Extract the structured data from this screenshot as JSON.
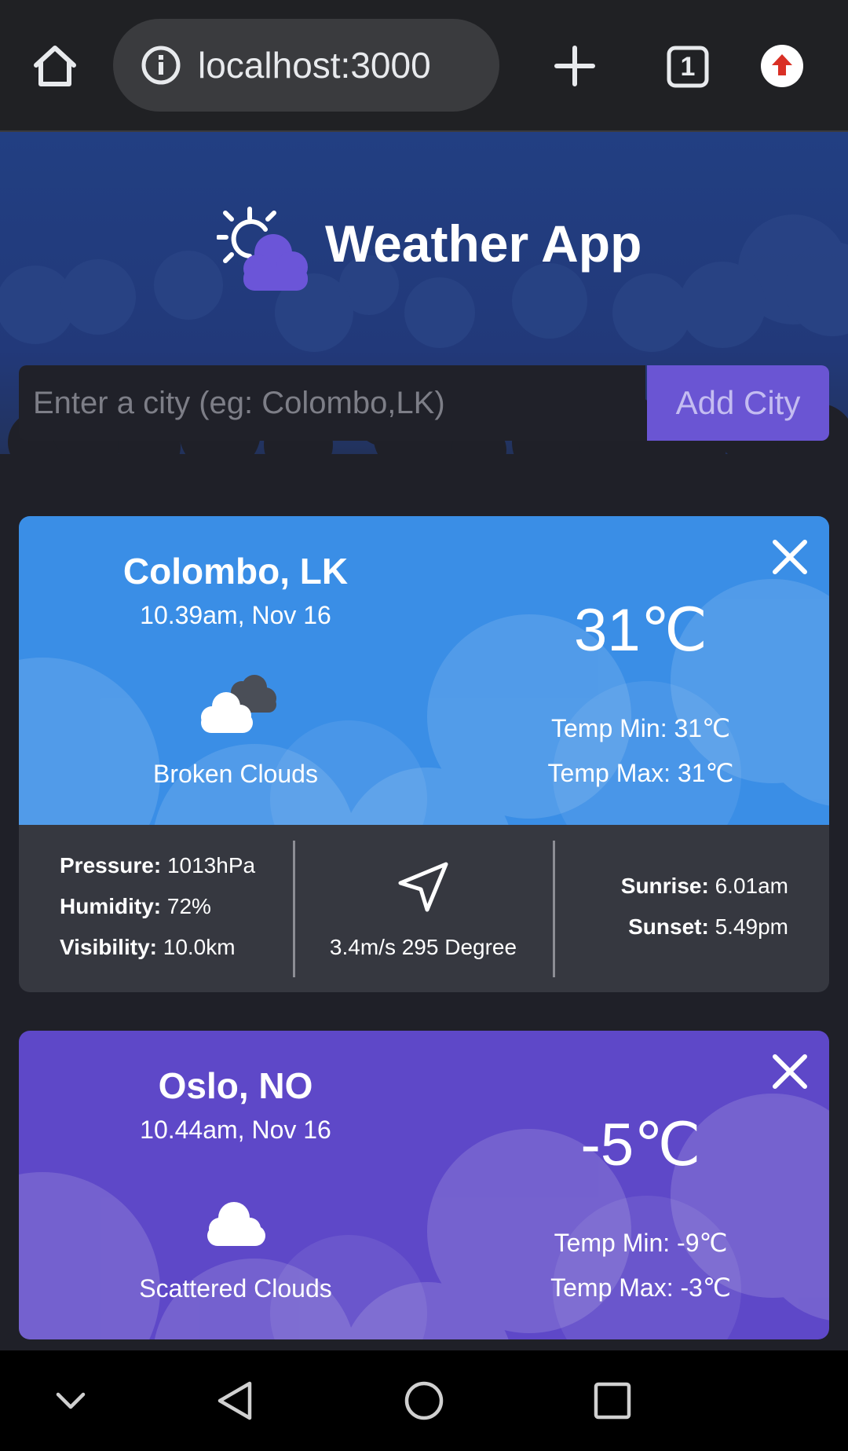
{
  "browser": {
    "url": "localhost:3000",
    "tab_count": "1"
  },
  "app": {
    "title": "Weather App"
  },
  "search": {
    "placeholder": "Enter a city (eg: Colombo,LK)",
    "value": "",
    "button_label": "Add City"
  },
  "cards": [
    {
      "city": "Colombo, LK",
      "time": "10.39am, Nov 16",
      "description": "Broken Clouds",
      "temp": "31℃",
      "temp_min": "Temp Min: 31℃",
      "temp_max": "Temp Max: 31℃",
      "icon": "broken-clouds-icon",
      "color": "#3a8ee6",
      "pressure_label": "Pressure:",
      "pressure": "1013hPa",
      "humidity_label": "Humidity:",
      "humidity": "72%",
      "visibility_label": "Visibility:",
      "visibility": "10.0km",
      "wind": "3.4m/s 295 Degree",
      "sunrise_label": "Sunrise:",
      "sunrise": "6.01am",
      "sunset_label": "Sunset:",
      "sunset": "5.49pm"
    },
    {
      "city": "Oslo, NO",
      "time": "10.44am, Nov 16",
      "description": "Scattered Clouds",
      "temp": "-5℃",
      "temp_min": "Temp Min: -9℃",
      "temp_max": "Temp Max: -3℃",
      "icon": "scattered-clouds-icon",
      "color": "#5e48c8"
    }
  ],
  "colors": {
    "hero_top": "#223f82",
    "page_bg": "#1f2028",
    "accent": "#6a55d3",
    "card_blue": "#3a8ee6",
    "card_purple": "#5e48c8",
    "details_bg": "#363840"
  }
}
